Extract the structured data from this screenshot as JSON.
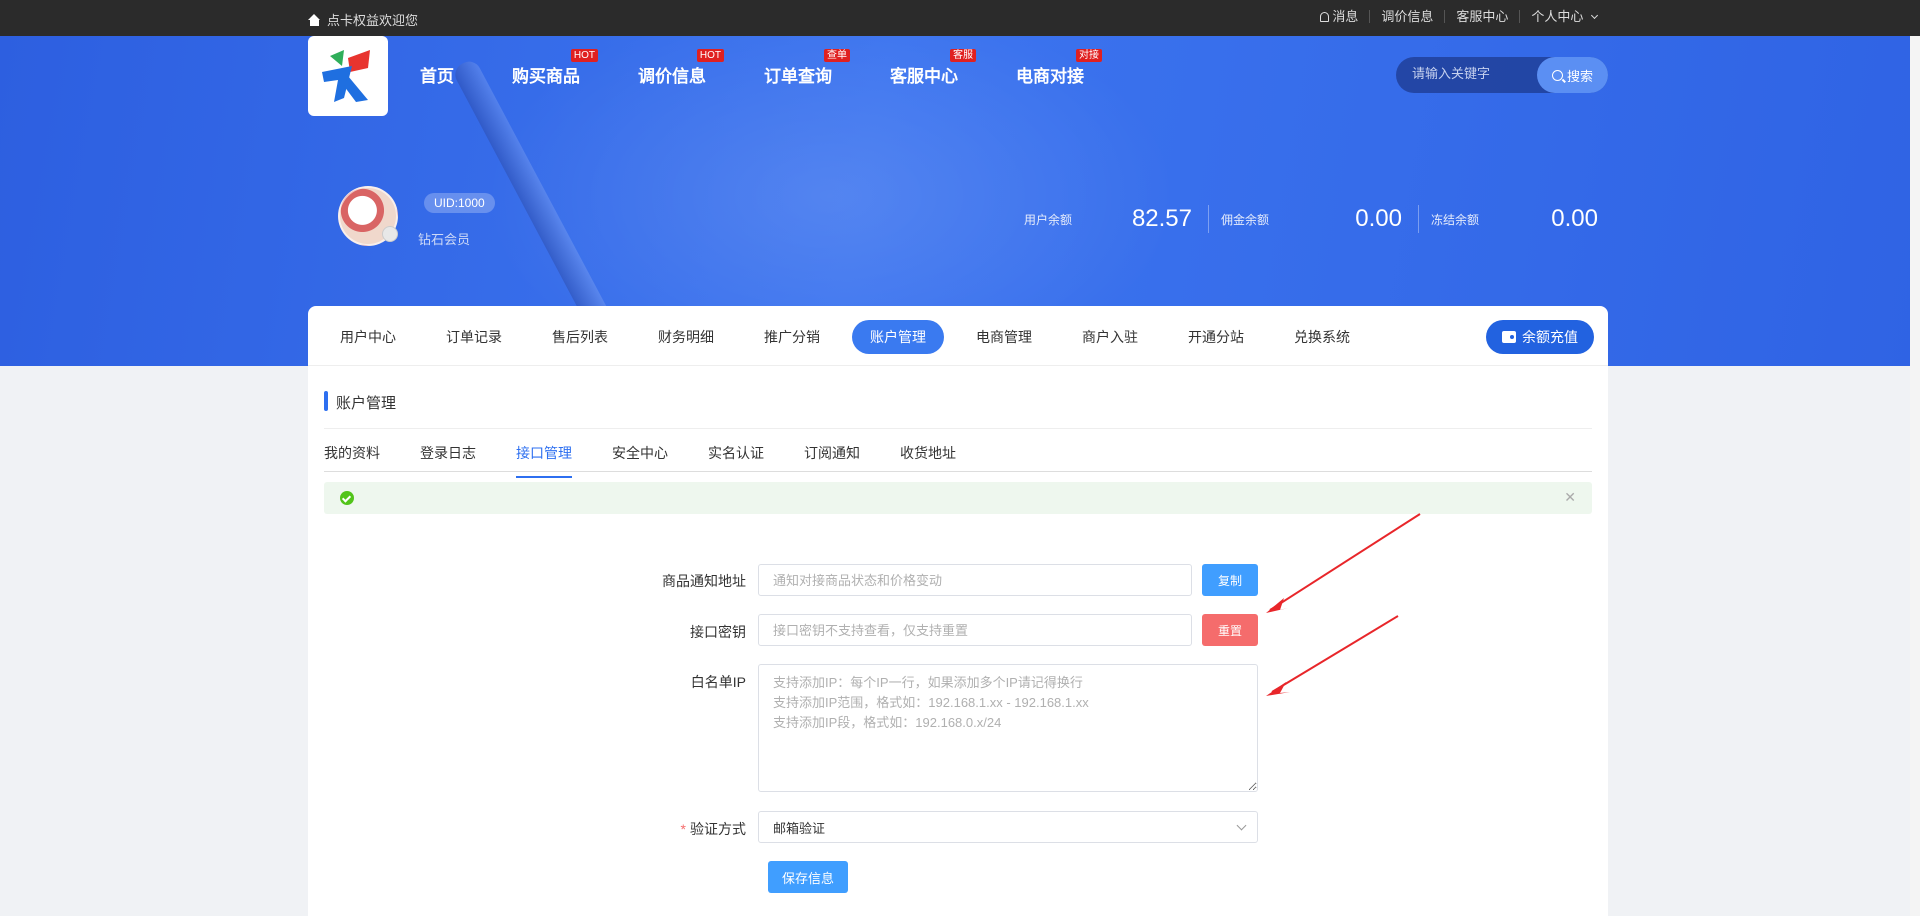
{
  "topbar": {
    "welcome": "点卡权益欢迎您",
    "links": [
      "消息",
      "调价信息",
      "客服中心",
      "个人中心"
    ]
  },
  "nav": {
    "items": [
      {
        "label": "首页",
        "badge": ""
      },
      {
        "label": "购买商品",
        "badge": "HOT"
      },
      {
        "label": "调价信息",
        "badge": "HOT"
      },
      {
        "label": "订单查询",
        "badge": "查单"
      },
      {
        "label": "客服中心",
        "badge": "客服"
      },
      {
        "label": "电商对接",
        "badge": "对接"
      }
    ],
    "search_placeholder": "请输入关键字",
    "search_button": "搜索"
  },
  "profile": {
    "uid": "UID:1000",
    "level": "钻石会员",
    "balances": [
      {
        "label": "用户余额",
        "value": "82.57"
      },
      {
        "label": "佣金余额",
        "value": "0.00"
      },
      {
        "label": "冻结余额",
        "value": "0.00"
      }
    ]
  },
  "tabs": {
    "items": [
      "用户中心",
      "订单记录",
      "售后列表",
      "财务明细",
      "推广分销",
      "账户管理",
      "电商管理",
      "商户入驻",
      "开通分站",
      "兑换系统"
    ],
    "active": "账户管理",
    "recharge": "余额充值"
  },
  "section": {
    "title": "账户管理",
    "subtabs": [
      "我的资料",
      "登录日志",
      "接口管理",
      "安全中心",
      "实名认证",
      "订阅通知",
      "收货地址"
    ],
    "active_subtab": "接口管理"
  },
  "form": {
    "notify_label": "商品通知地址",
    "notify_placeholder": "通知对接商品状态和价格变动",
    "copy_button": "复制",
    "secret_label": "接口密钥",
    "secret_placeholder": "接口密钥不支持查看，仅支持重置",
    "reset_button": "重置",
    "whitelist_label": "白名单IP",
    "whitelist_placeholder": "支持添加IP：每个IP一行，如果添加多个IP请记得换行\n支持添加IP范围，格式如：192.168.1.xx - 192.168.1.xx\n支持添加IP段，格式如：192.168.0.x/24",
    "verify_label": "验证方式",
    "verify_value": "邮箱验证",
    "save_button": "保存信息"
  },
  "colors": {
    "primary": "#2d6ff0",
    "copy": "#409eff",
    "reset": "#f56c6c",
    "arrow": "#e8262a"
  }
}
